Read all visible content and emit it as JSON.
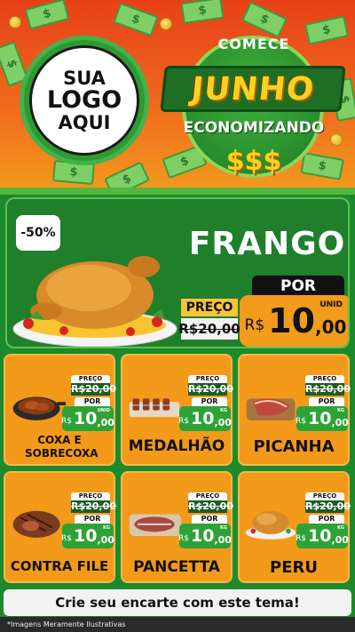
{
  "header": {
    "logo_line1": "SUA",
    "logo_line2": "LOGO",
    "logo_line3": "AQUI",
    "badge_top": "COMECE",
    "badge_main": "JUNHO",
    "badge_sub": "ECONOMIZANDO",
    "badge_symbols": "$$$"
  },
  "featured": {
    "discount": "-50%",
    "name": "FRANGO",
    "old_label": "PREÇO",
    "old_price": "R$20,00",
    "new_label": "POR",
    "currency": "R$",
    "price_int": "10",
    "price_dec": ",00",
    "unit": "UNID"
  },
  "products": [
    {
      "name": "COXA E SOBRECOXA",
      "old_label": "PREÇO",
      "old_price": "R$20,00",
      "new_label": "POR",
      "currency": "R$",
      "price_int": "10",
      "price_dec": ",00",
      "unit": "UNID",
      "icon": "chicken-pan-icon"
    },
    {
      "name": "MEDALHÃO",
      "old_label": "PREÇO",
      "old_price": "R$20,00",
      "new_label": "POR",
      "currency": "R$",
      "price_int": "10",
      "price_dec": ",00",
      "unit": "KG",
      "icon": "skewers-icon"
    },
    {
      "name": "PICANHA",
      "old_label": "PREÇO",
      "old_price": "R$20,00",
      "new_label": "POR",
      "currency": "R$",
      "price_int": "10",
      "price_dec": ",00",
      "unit": "KG",
      "icon": "steak-board-icon"
    },
    {
      "name": "CONTRA FILE",
      "old_label": "PREÇO",
      "old_price": "R$20,00",
      "new_label": "POR",
      "currency": "R$",
      "price_int": "10",
      "price_dec": ",00",
      "unit": "KG",
      "icon": "grilled-steak-icon"
    },
    {
      "name": "PANCETTA",
      "old_label": "PREÇO",
      "old_price": "R$20,00",
      "new_label": "POR",
      "currency": "R$",
      "price_int": "10",
      "price_dec": ",00",
      "unit": "KG",
      "icon": "pancetta-icon"
    },
    {
      "name": "PERU",
      "old_label": "PREÇO",
      "old_price": "R$20,00",
      "new_label": "POR",
      "currency": "R$",
      "price_int": "10",
      "price_dec": ",00",
      "unit": "KG",
      "icon": "roast-turkey-icon"
    }
  ],
  "cta": "Crie seu encarte com este tema!",
  "footer_note": "*Imagens Meramente Ilustrativas",
  "colors": {
    "orange": "#f39a1a",
    "green": "#1f7f2b",
    "yellow": "#ffd21f",
    "red_orange": "#e8401a"
  }
}
